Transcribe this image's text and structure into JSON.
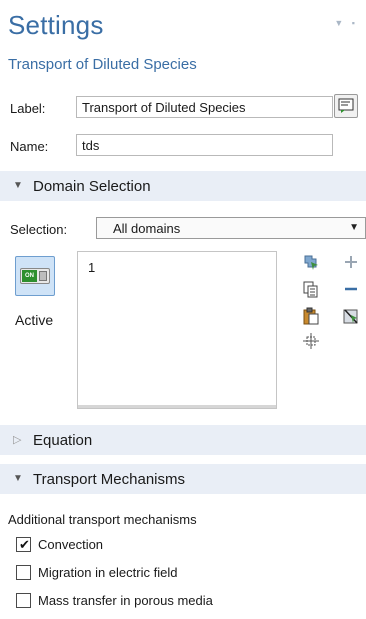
{
  "header": {
    "title": "Settings",
    "subtitle": "Transport of Diluted Species"
  },
  "label_field": {
    "label": "Label:",
    "value": "Transport of Diluted Species"
  },
  "name_field": {
    "label": "Name:",
    "value": "tds"
  },
  "domain_selection": {
    "section_label": "Domain Selection",
    "selection_label": "Selection:",
    "selected_option": "All domains",
    "active_label": "Active",
    "toggle_text": "ON",
    "domains": [
      "1"
    ]
  },
  "equation": {
    "section_label": "Equation"
  },
  "transport_mechanisms": {
    "section_label": "Transport Mechanisms",
    "description": "Additional transport mechanisms",
    "options": [
      {
        "label": "Convection",
        "checked": true
      },
      {
        "label": "Migration in electric field",
        "checked": false
      },
      {
        "label": "Mass transfer in porous media",
        "checked": false
      }
    ]
  },
  "colors": {
    "title": "#3a6ea5",
    "section_bg": "#e9eef6",
    "toggle_on": "#2e8f2e"
  },
  "icons": [
    "pin-icon",
    "label-edit-icon",
    "chevron-down-icon",
    "chevron-right-icon",
    "select-domain-icon",
    "add-icon",
    "copy-icon",
    "remove-icon",
    "paste-icon",
    "clear-selection-icon",
    "zoom-to-selection-icon"
  ]
}
